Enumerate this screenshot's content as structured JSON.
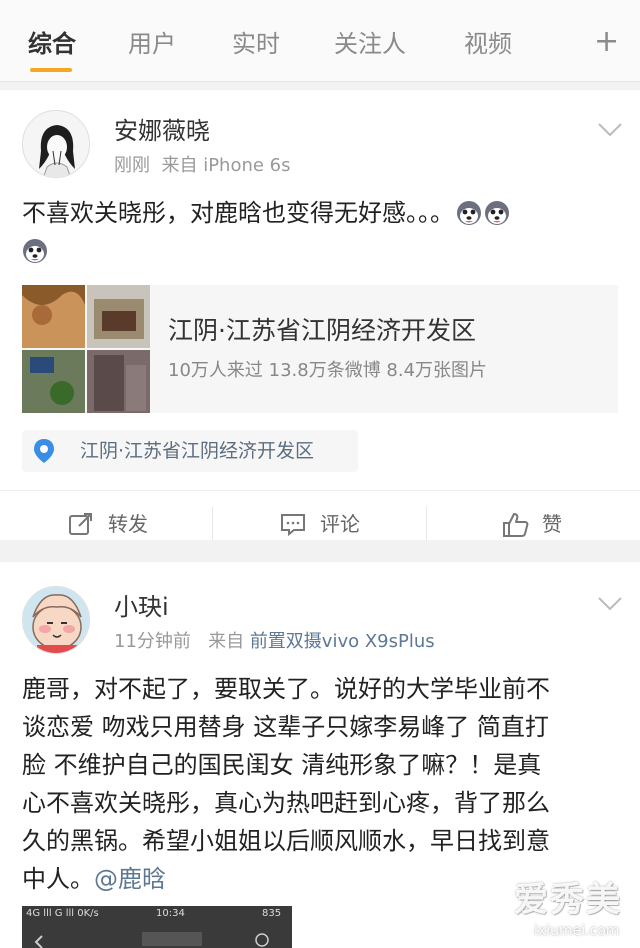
{
  "tabs": [
    {
      "label": "综合",
      "active": true
    },
    {
      "label": "用户",
      "active": false
    },
    {
      "label": "实时",
      "active": false
    },
    {
      "label": "关注人",
      "active": false
    },
    {
      "label": "视频",
      "active": false
    }
  ],
  "tab_add_glyph": "+",
  "colors": {
    "accent": "#f5a623",
    "link": "#5d7895",
    "location_pin": "#3a8ee6"
  },
  "post1": {
    "username": "安娜薇晓",
    "time": "刚刚",
    "source_prefix": "来自",
    "source": "iPhone 6s",
    "text": "不喜欢关晓彤，对鹿晗也变得无好感。。。",
    "emoji_icon": "husky-face-icon",
    "poi": {
      "title": "江阴·江苏省江阴经济开发区",
      "stats": "10万人来过 13.8万条微博 8.4万张图片"
    },
    "location": "江阴·江苏省江阴经济开发区",
    "actions": {
      "repost": "转发",
      "comment": "评论",
      "like": "赞"
    }
  },
  "post2": {
    "username": "小玦i",
    "time": "11分钟前",
    "source_prefix": "来自",
    "source": "前置双摄vivo X9sPlus",
    "text_lines": [
      "鹿哥，对不起了，要取关了。说好的大学毕业前不",
      "谈恋爱 吻戏只用替身 这辈子只嫁李易峰了 简直打",
      "脸 不维护自己的国民闺女 清纯形象了嘛？！是真",
      "心不喜欢关晓彤，真心为热吧赶到心疼，背了那么",
      "久的黑锅。希望小姐姐以后顺风顺水，早日找到意",
      "中人。"
    ],
    "mention": "@鹿晗",
    "screenshot_status": {
      "left": "4G lll G lll 0K/s",
      "time": "10:34",
      "right": "835"
    }
  },
  "watermark": {
    "brand": "爱秀美",
    "domain": "ixiumei.com"
  }
}
